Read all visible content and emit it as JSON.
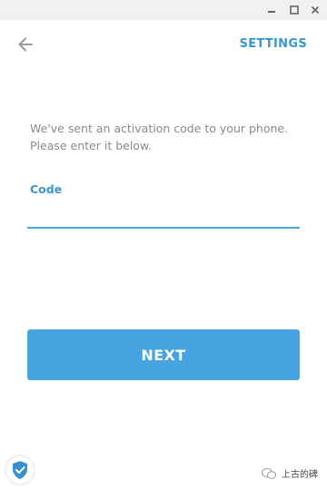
{
  "header": {
    "settings_label": "SETTINGS"
  },
  "icons": {
    "back": "arrow-left-icon",
    "minimize": "minimize-icon",
    "maximize": "maximize-icon",
    "close": "close-icon",
    "shield": "shield-check-icon",
    "watermark": "wechat-icon"
  },
  "form": {
    "info_line1": "We've sent an activation code to your phone.",
    "info_line2": "Please enter it below.",
    "code_label": "Code",
    "code_value": "",
    "next_label": "NEXT"
  },
  "footer": {
    "watermark_text": "上古的碑"
  },
  "colors": {
    "accent": "#3a95cf",
    "button": "#46a5e1",
    "titlebar": "#f1f1f1",
    "info_text": "#8a8a8a"
  }
}
